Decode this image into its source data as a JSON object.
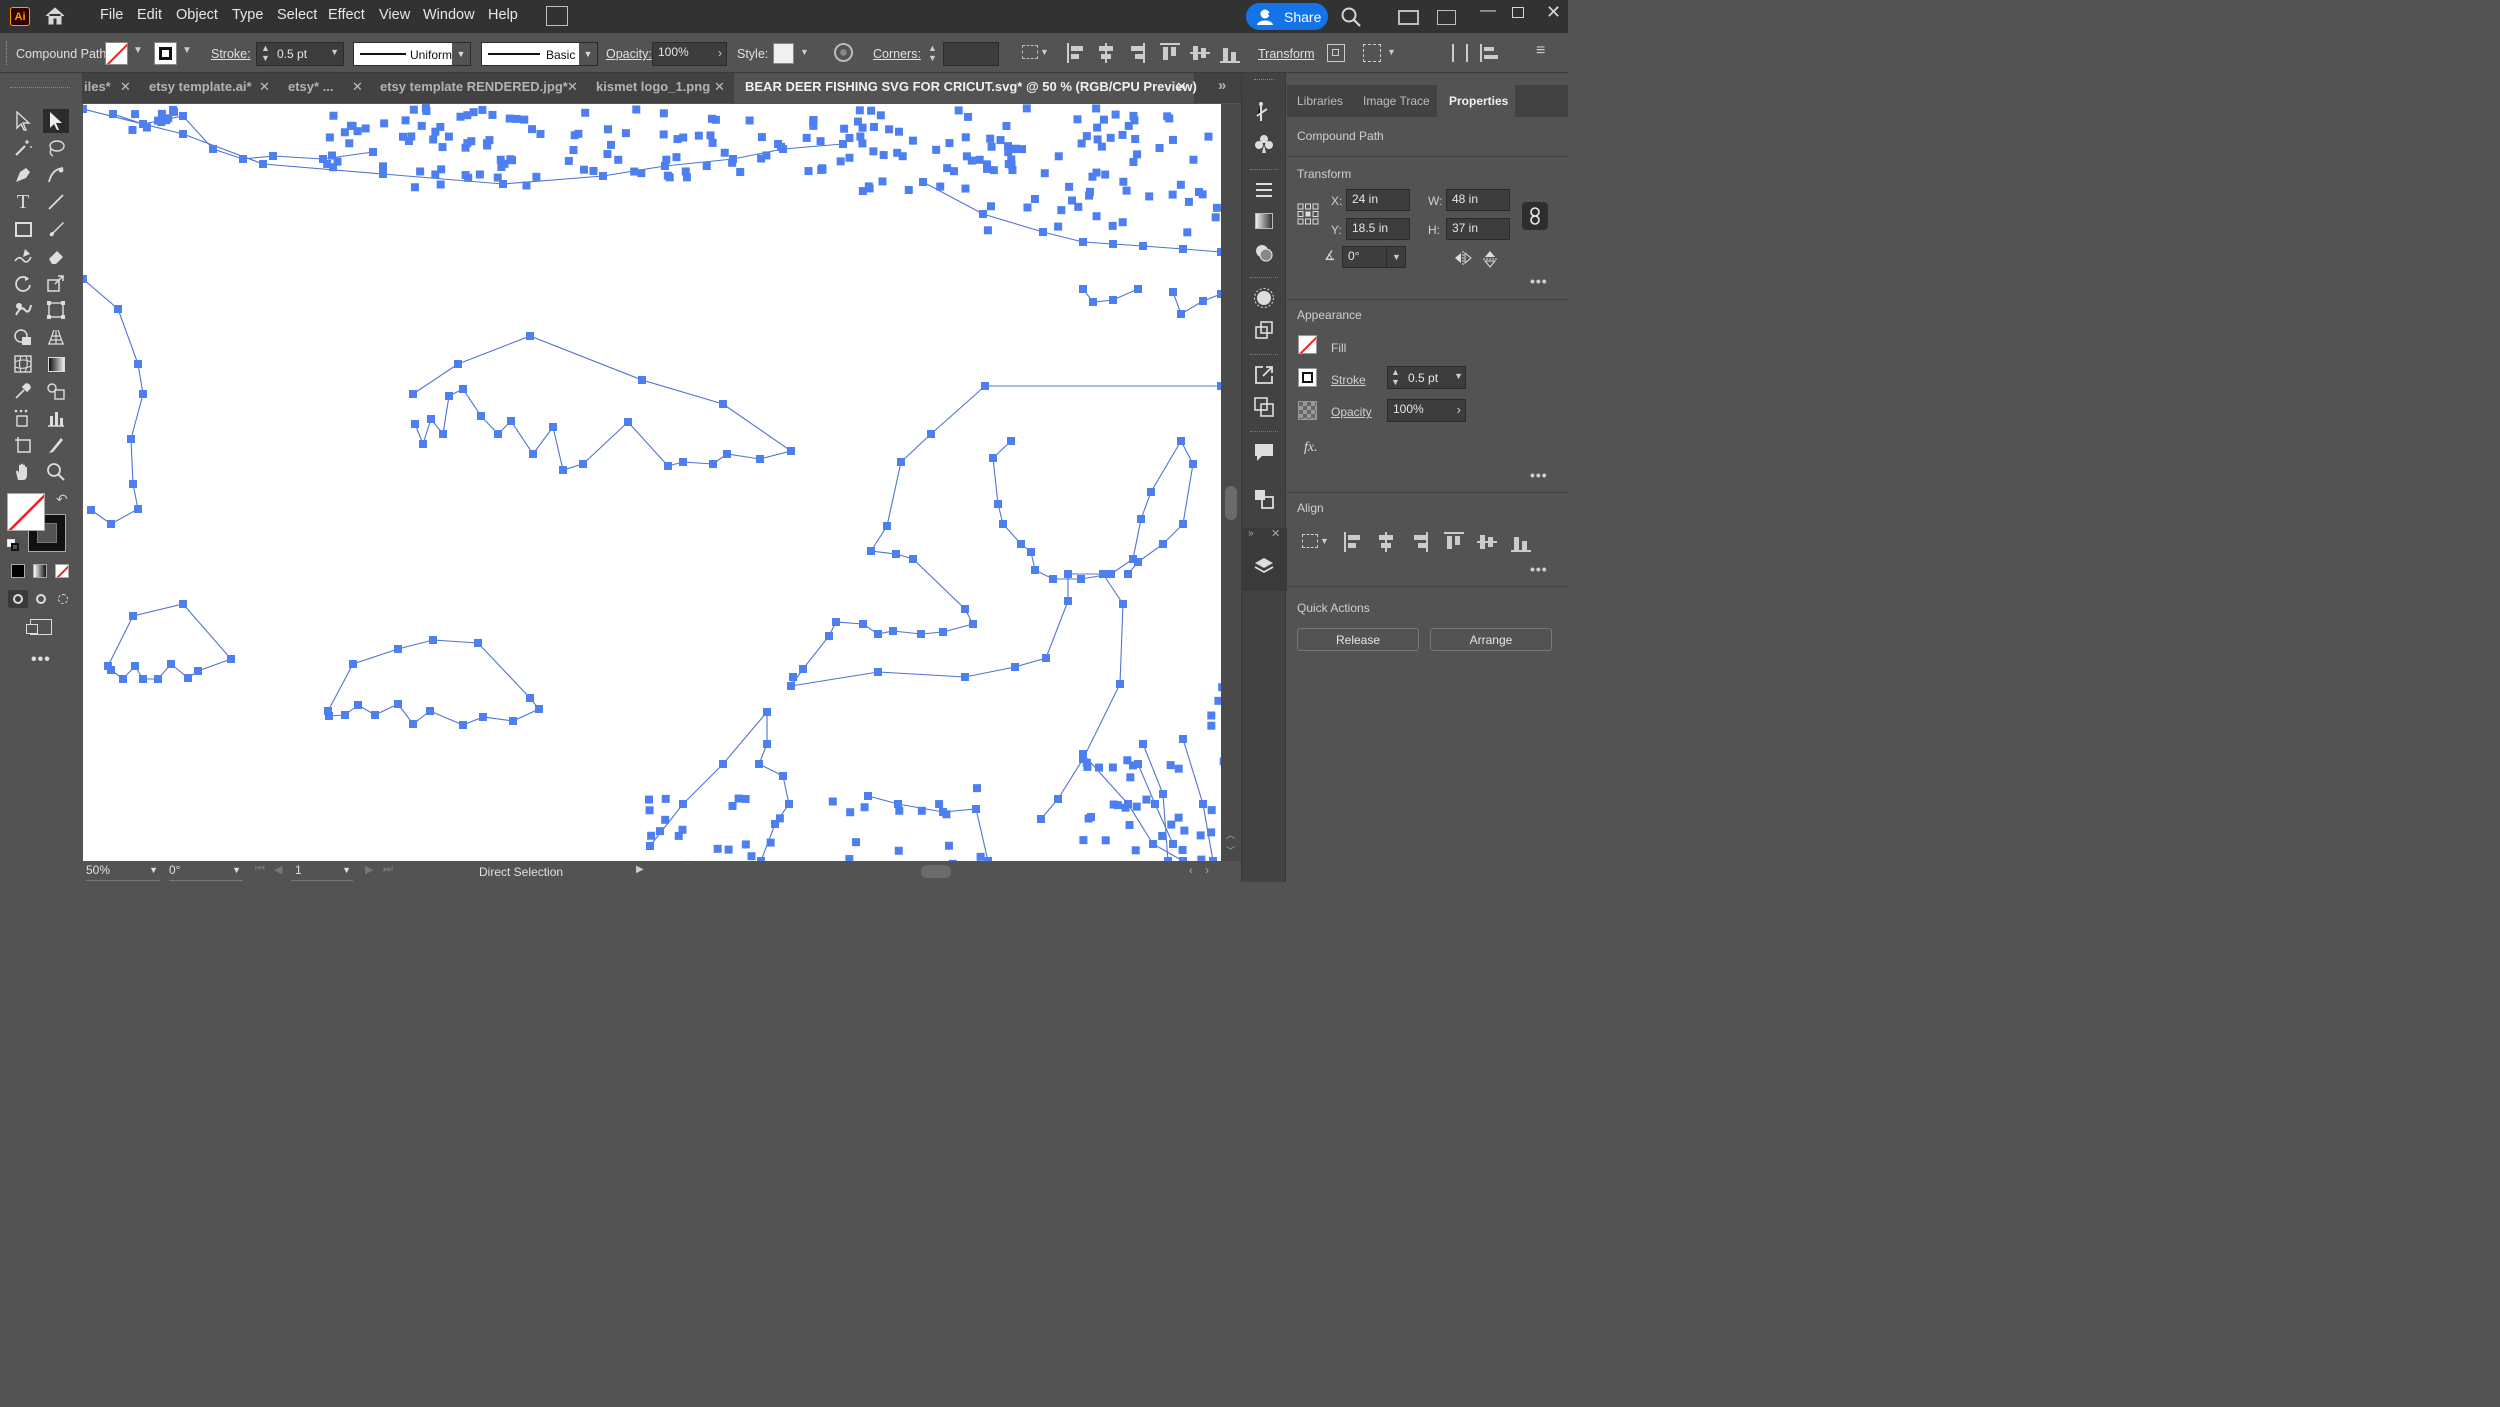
{
  "app": {
    "logo": "Ai"
  },
  "menu": [
    "File",
    "Edit",
    "Object",
    "Type",
    "Select",
    "Effect",
    "View",
    "Window",
    "Help"
  ],
  "share_label": "Share",
  "control": {
    "selection_type": "Compound Path",
    "stroke_label": "Stroke:",
    "stroke_value": "0.5 pt",
    "profile_label": "Uniform",
    "brush_label": "Basic",
    "opacity_label": "Opacity:",
    "opacity_value": "100%",
    "style_label": "Style:",
    "corners_label": "Corners:",
    "transform_label": "Transform"
  },
  "tabs": [
    {
      "label": "iles*",
      "active": false
    },
    {
      "label": "etsy template.ai*",
      "active": false
    },
    {
      "label": "etsy* ...",
      "active": false
    },
    {
      "label": "etsy template RENDERED.jpg*",
      "active": false
    },
    {
      "label": "kismet logo_1.png",
      "active": false
    },
    {
      "label": "BEAR DEER FISHING SVG FOR CRICUT.svg* @ 50 % (RGB/CPU Preview)",
      "active": true
    }
  ],
  "status": {
    "zoom": "50%",
    "rotation": "0°",
    "artboard": "1",
    "tool": "Direct Selection"
  },
  "panel": {
    "tabs": [
      "Libraries",
      "Image Trace",
      "Properties"
    ],
    "active_tab": "Properties",
    "object_type": "Compound Path",
    "transform": {
      "title": "Transform",
      "x_label": "X:",
      "x": "24 in",
      "y_label": "Y:",
      "y": "18.5 in",
      "w_label": "W:",
      "w": "48 in",
      "h_label": "H:",
      "h": "37 in",
      "angle": "0°"
    },
    "appearance": {
      "title": "Appearance",
      "fill_label": "Fill",
      "stroke_label": "Stroke",
      "stroke_value": "0.5 pt",
      "opacity_label": "Opacity",
      "opacity_value": "100%",
      "fx_label": "fx."
    },
    "align": {
      "title": "Align"
    },
    "quick_actions": {
      "title": "Quick Actions",
      "release": "Release",
      "arrange": "Arrange"
    }
  },
  "colors": {
    "accent": "#1473e6",
    "anchor": "#4d7ff0",
    "path": "#4f74d6",
    "ui_dark": "#323232",
    "ui_mid": "#535353"
  }
}
